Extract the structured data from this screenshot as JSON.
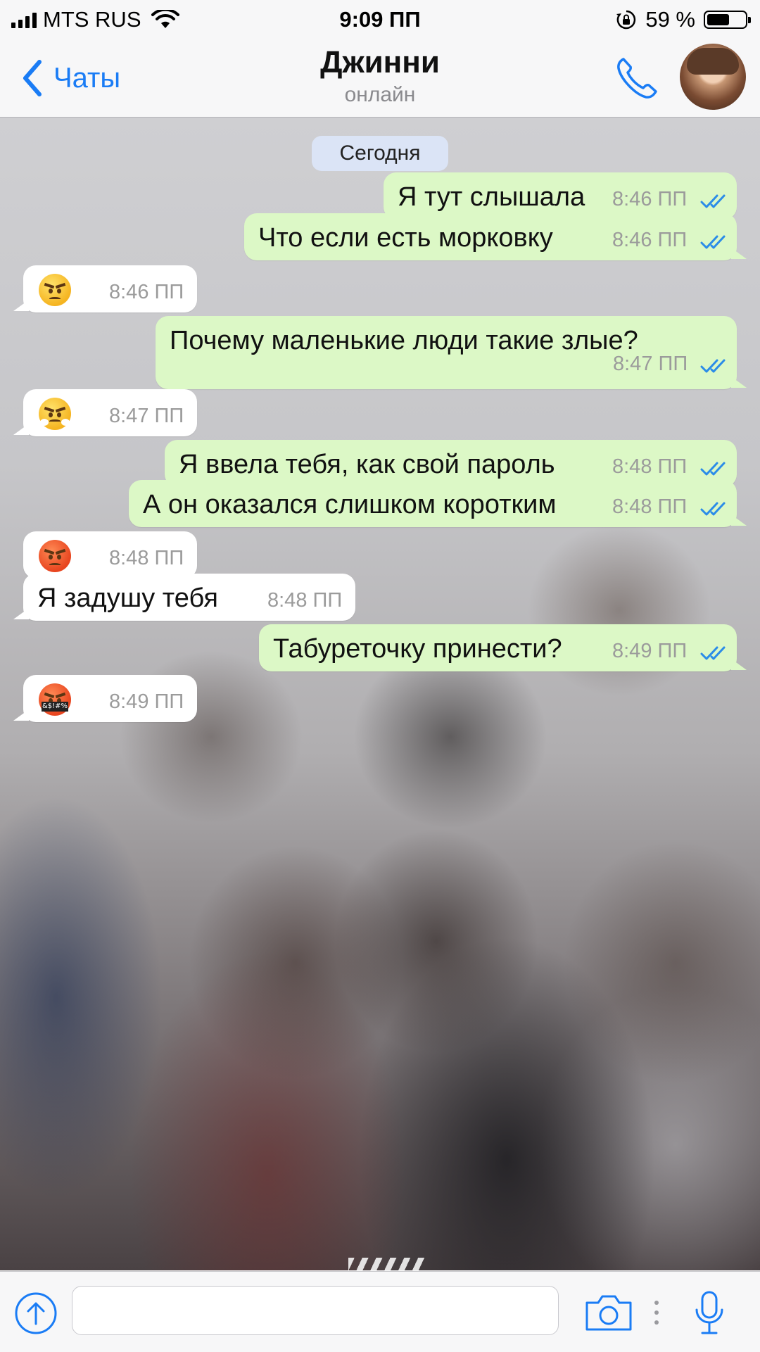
{
  "status_bar": {
    "carrier": "MTS RUS",
    "time": "9:09 ПП",
    "battery": "59 %",
    "battery_level": 0.59,
    "icons": [
      "signal-icon",
      "wifi-icon",
      "orientation-lock-icon",
      "battery-icon"
    ]
  },
  "nav": {
    "back_label": "Чаты",
    "contact_name": "Джинни",
    "contact_status": "онлайн",
    "icons": [
      "chevron-left-icon",
      "phone-icon",
      "avatar"
    ]
  },
  "chat": {
    "date_label": "Сегодня",
    "messages": [
      {
        "direction": "out",
        "text": "Я тут слышала",
        "time": "8:46 ПП",
        "read": true
      },
      {
        "direction": "out",
        "text": "Что если есть морковку",
        "time": "8:46 ПП",
        "read": true
      },
      {
        "direction": "in",
        "emoji": "angry-face-emoji",
        "time": "8:46 ПП"
      },
      {
        "direction": "out",
        "text": "Почему маленькие люди такие злые?",
        "time": "8:47 ПП",
        "read": true
      },
      {
        "direction": "in",
        "emoji": "face-with-steam-emoji",
        "time": "8:47 ПП"
      },
      {
        "direction": "out",
        "text": "Я ввела тебя, как свой пароль",
        "time": "8:48 ПП",
        "read": true
      },
      {
        "direction": "out",
        "text": "А он оказался слишком коротким",
        "time": "8:48 ПП",
        "read": true
      },
      {
        "direction": "in",
        "emoji": "pouting-face-emoji",
        "time": "8:48 ПП"
      },
      {
        "direction": "in",
        "text": "Я задушу тебя",
        "time": "8:48 ПП"
      },
      {
        "direction": "out",
        "text": "Табуреточку принести?",
        "time": "8:49 ПП",
        "read": true
      },
      {
        "direction": "in",
        "emoji": "face-with-symbols-emoji",
        "emoji_text": "&$!#%",
        "time": "8:49 ПП"
      }
    ]
  },
  "input_bar": {
    "placeholder": "",
    "icons": [
      "attach-icon",
      "camera-icon",
      "more-dots-icon",
      "microphone-icon"
    ]
  },
  "colors": {
    "accent": "#1a7cf5",
    "outgoing_bubble": "#dcf8c6",
    "incoming_bubble": "#ffffff",
    "date_pill": "#dbe4f6",
    "read_checks": "#2b8ce8"
  }
}
